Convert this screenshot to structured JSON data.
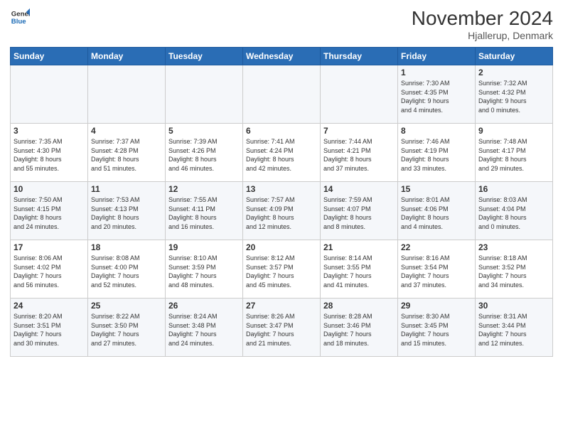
{
  "logo": {
    "line1": "General",
    "line2": "Blue"
  },
  "title": "November 2024",
  "location": "Hjallerup, Denmark",
  "days_of_week": [
    "Sunday",
    "Monday",
    "Tuesday",
    "Wednesday",
    "Thursday",
    "Friday",
    "Saturday"
  ],
  "weeks": [
    [
      {
        "day": "",
        "info": ""
      },
      {
        "day": "",
        "info": ""
      },
      {
        "day": "",
        "info": ""
      },
      {
        "day": "",
        "info": ""
      },
      {
        "day": "",
        "info": ""
      },
      {
        "day": "1",
        "info": "Sunrise: 7:30 AM\nSunset: 4:35 PM\nDaylight: 9 hours\nand 4 minutes."
      },
      {
        "day": "2",
        "info": "Sunrise: 7:32 AM\nSunset: 4:32 PM\nDaylight: 9 hours\nand 0 minutes."
      }
    ],
    [
      {
        "day": "3",
        "info": "Sunrise: 7:35 AM\nSunset: 4:30 PM\nDaylight: 8 hours\nand 55 minutes."
      },
      {
        "day": "4",
        "info": "Sunrise: 7:37 AM\nSunset: 4:28 PM\nDaylight: 8 hours\nand 51 minutes."
      },
      {
        "day": "5",
        "info": "Sunrise: 7:39 AM\nSunset: 4:26 PM\nDaylight: 8 hours\nand 46 minutes."
      },
      {
        "day": "6",
        "info": "Sunrise: 7:41 AM\nSunset: 4:24 PM\nDaylight: 8 hours\nand 42 minutes."
      },
      {
        "day": "7",
        "info": "Sunrise: 7:44 AM\nSunset: 4:21 PM\nDaylight: 8 hours\nand 37 minutes."
      },
      {
        "day": "8",
        "info": "Sunrise: 7:46 AM\nSunset: 4:19 PM\nDaylight: 8 hours\nand 33 minutes."
      },
      {
        "day": "9",
        "info": "Sunrise: 7:48 AM\nSunset: 4:17 PM\nDaylight: 8 hours\nand 29 minutes."
      }
    ],
    [
      {
        "day": "10",
        "info": "Sunrise: 7:50 AM\nSunset: 4:15 PM\nDaylight: 8 hours\nand 24 minutes."
      },
      {
        "day": "11",
        "info": "Sunrise: 7:53 AM\nSunset: 4:13 PM\nDaylight: 8 hours\nand 20 minutes."
      },
      {
        "day": "12",
        "info": "Sunrise: 7:55 AM\nSunset: 4:11 PM\nDaylight: 8 hours\nand 16 minutes."
      },
      {
        "day": "13",
        "info": "Sunrise: 7:57 AM\nSunset: 4:09 PM\nDaylight: 8 hours\nand 12 minutes."
      },
      {
        "day": "14",
        "info": "Sunrise: 7:59 AM\nSunset: 4:07 PM\nDaylight: 8 hours\nand 8 minutes."
      },
      {
        "day": "15",
        "info": "Sunrise: 8:01 AM\nSunset: 4:06 PM\nDaylight: 8 hours\nand 4 minutes."
      },
      {
        "day": "16",
        "info": "Sunrise: 8:03 AM\nSunset: 4:04 PM\nDaylight: 8 hours\nand 0 minutes."
      }
    ],
    [
      {
        "day": "17",
        "info": "Sunrise: 8:06 AM\nSunset: 4:02 PM\nDaylight: 7 hours\nand 56 minutes."
      },
      {
        "day": "18",
        "info": "Sunrise: 8:08 AM\nSunset: 4:00 PM\nDaylight: 7 hours\nand 52 minutes."
      },
      {
        "day": "19",
        "info": "Sunrise: 8:10 AM\nSunset: 3:59 PM\nDaylight: 7 hours\nand 48 minutes."
      },
      {
        "day": "20",
        "info": "Sunrise: 8:12 AM\nSunset: 3:57 PM\nDaylight: 7 hours\nand 45 minutes."
      },
      {
        "day": "21",
        "info": "Sunrise: 8:14 AM\nSunset: 3:55 PM\nDaylight: 7 hours\nand 41 minutes."
      },
      {
        "day": "22",
        "info": "Sunrise: 8:16 AM\nSunset: 3:54 PM\nDaylight: 7 hours\nand 37 minutes."
      },
      {
        "day": "23",
        "info": "Sunrise: 8:18 AM\nSunset: 3:52 PM\nDaylight: 7 hours\nand 34 minutes."
      }
    ],
    [
      {
        "day": "24",
        "info": "Sunrise: 8:20 AM\nSunset: 3:51 PM\nDaylight: 7 hours\nand 30 minutes."
      },
      {
        "day": "25",
        "info": "Sunrise: 8:22 AM\nSunset: 3:50 PM\nDaylight: 7 hours\nand 27 minutes."
      },
      {
        "day": "26",
        "info": "Sunrise: 8:24 AM\nSunset: 3:48 PM\nDaylight: 7 hours\nand 24 minutes."
      },
      {
        "day": "27",
        "info": "Sunrise: 8:26 AM\nSunset: 3:47 PM\nDaylight: 7 hours\nand 21 minutes."
      },
      {
        "day": "28",
        "info": "Sunrise: 8:28 AM\nSunset: 3:46 PM\nDaylight: 7 hours\nand 18 minutes."
      },
      {
        "day": "29",
        "info": "Sunrise: 8:30 AM\nSunset: 3:45 PM\nDaylight: 7 hours\nand 15 minutes."
      },
      {
        "day": "30",
        "info": "Sunrise: 8:31 AM\nSunset: 3:44 PM\nDaylight: 7 hours\nand 12 minutes."
      }
    ]
  ]
}
